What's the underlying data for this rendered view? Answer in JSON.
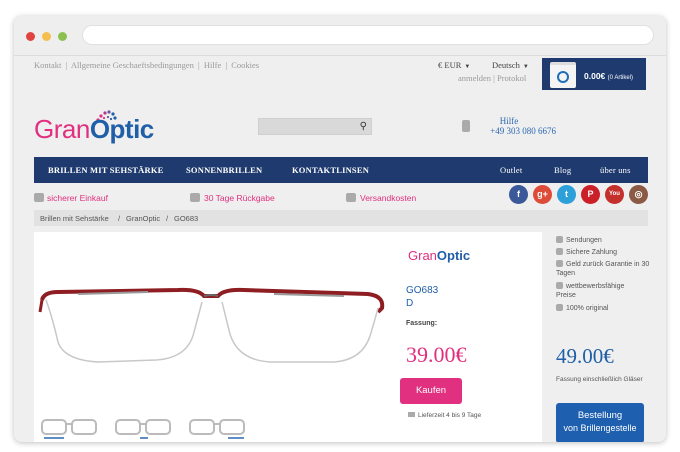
{
  "browser": {
    "colors": {
      "close": "#e0443e",
      "minimize": "#f5be4f",
      "maximize": "#8cc152"
    }
  },
  "topbar": {
    "links": [
      "Kontakt",
      "|",
      "Allgemeine Geschaeftsbedingungen",
      "|",
      "Hilfe",
      "|",
      "Cookies"
    ],
    "currency": "€ EUR",
    "language": "Deutsch",
    "account": "anmelden | Protokol",
    "cart_amount": "0.00€",
    "cart_count": "(0 Artikel)"
  },
  "logo": {
    "part1": "Gran",
    "part2": "Optic"
  },
  "help": {
    "label": "Hilfe",
    "phone": "+49 303 080 6676"
  },
  "nav": {
    "items": [
      "BRILLEN MIT SEHSTÄRKE",
      "SONNENBRILLEN",
      "KONTAKTLINSEN"
    ],
    "right": [
      "Outlet",
      "Blog",
      "über uns"
    ]
  },
  "trust": {
    "items": [
      "sicherer Einkauf",
      "30 Tage Rückgabe",
      "Versandkosten"
    ]
  },
  "social": [
    {
      "icon": "facebook-icon",
      "glyph": "f",
      "color": "#3b5998"
    },
    {
      "icon": "googleplus-icon",
      "glyph": "g+",
      "color": "#dd4b39"
    },
    {
      "icon": "twitter-icon",
      "glyph": "t",
      "color": "#2d9fd9"
    },
    {
      "icon": "pinterest-icon",
      "glyph": "P",
      "color": "#cb2027"
    },
    {
      "icon": "youtube-icon",
      "glyph": "You",
      "color": "#c4302b"
    },
    {
      "icon": "instagram-icon",
      "glyph": "◎",
      "color": "#8a5a44"
    }
  ],
  "breadcrumb": [
    "Brillen mit Sehstärke",
    "/",
    "GranOptic",
    "/",
    "GO683"
  ],
  "product": {
    "brand1": "Gran",
    "brand2": "Optic",
    "code": "GO683",
    "variant": "D",
    "frame_label": "Fassung:",
    "price": "39.00€",
    "buy_label": "Kaufen",
    "delivery": "Lieferzeit 4 bis 9 Tage",
    "frame_color": "#8e1e22"
  },
  "sidebar": {
    "items": [
      "Sendungen",
      "Sichere Zahlung",
      "Geld zurück Garantie in 30 Tagen",
      "wettbewerbsfähige Preise",
      "100% original"
    ],
    "price": "49.00€",
    "note": "Fassung einschließlich Gläser",
    "order_line1": "Bestellung",
    "order_line2": "von Brillengestelle"
  }
}
